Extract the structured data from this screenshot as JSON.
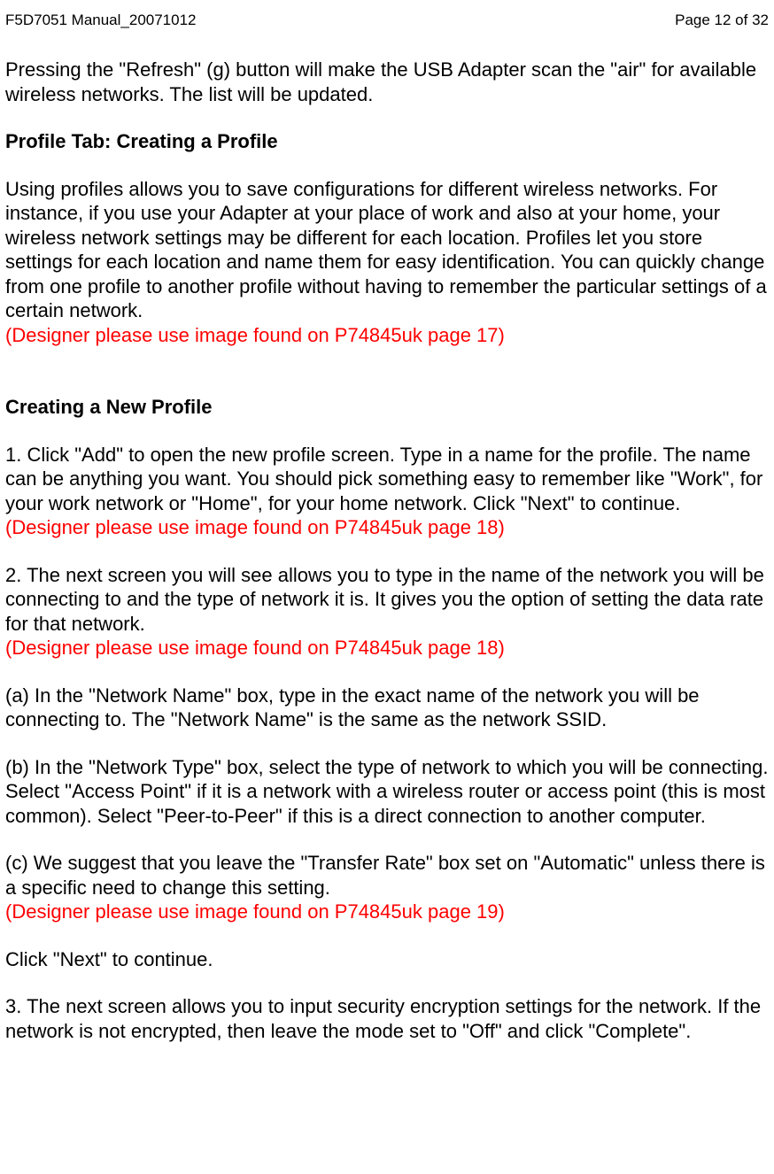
{
  "header": {
    "left": "F5D7051 Manual_20071012",
    "right": "Page 12 of 32"
  },
  "p1": "Pressing the \"Refresh\" (g) button will make the USB Adapter scan the \"air\" for available wireless networks. The list will be updated.",
  "h1": "Profile Tab: Creating a Profile",
  "p2": "Using profiles allows you to save configurations for different wireless networks. For instance, if you use your Adapter at your place of work and also at your home, your wireless network settings may be different for each location. Profiles let you store settings for each location and name them for easy identification. You can quickly change from one profile to another profile without having to remember the particular settings of a certain network.",
  "r1": "(Designer please use image found on P74845uk page 17)",
  "h2": "Creating a New Profile",
  "p3": "1. Click \"Add\" to open the new profile screen. Type in a name for the profile. The name can be anything you want. You should pick something easy to remember like \"Work\", for your work network or \"Home\", for your home network. Click \"Next\" to continue.",
  "r2": "(Designer please use image found on P74845uk page 18)",
  "p4": "2. The next screen you will see allows you to type in the name of the network you will be connecting to and the type of network it is. It gives you the option of setting the data rate for that network.",
  "r3": "(Designer please use image found on P74845uk page 18)",
  "p5": "(a) In the \"Network Name\" box, type in the exact name of the network you will be connecting to. The \"Network Name\" is the same as the network SSID.",
  "p6": "(b) In the \"Network Type\" box, select the type of network to which you will be connecting. Select \"Access Point\" if it is a network with a wireless router or access point (this is most common). Select \"Peer-to-Peer\" if this is a direct connection to another computer.",
  "p7": "(c) We suggest that you leave the \"Transfer Rate\" box set on \"Automatic\" unless there is a specific need to change this setting.",
  "r4": "(Designer please use image found on P74845uk page 19)",
  "p8": "Click \"Next\" to continue.",
  "p9": "3. The next screen allows you to input security encryption settings for the network. If the network is not encrypted, then leave the mode set to \"Off\" and click \"Complete\"."
}
